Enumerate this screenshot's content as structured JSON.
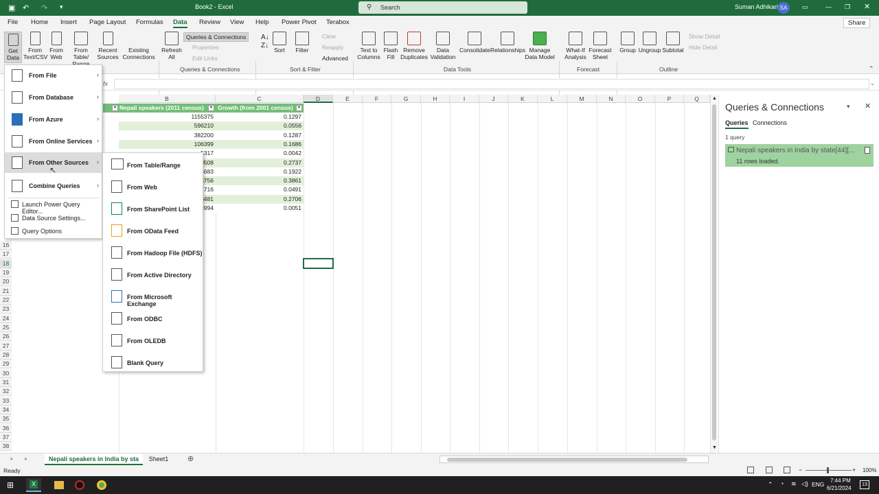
{
  "window": {
    "title": "Book2 - Excel",
    "search_placeholder": "Search",
    "user": "Suman Adhikari",
    "avatar": "SA",
    "share": "Share"
  },
  "menu": [
    "File",
    "Home",
    "Insert",
    "Page Layout",
    "Formulas",
    "Data",
    "Review",
    "View",
    "Help",
    "Power Pivot",
    "Terabox"
  ],
  "ribbon": {
    "get_data": "Get Data",
    "from_text_csv": "From Text/CSV",
    "from_web": "From Web",
    "from_table_range": "From Table/ Range",
    "recent_sources": "Recent Sources",
    "existing_connections": "Existing Connections",
    "refresh_all": "Refresh All",
    "queries_connections": "Queries & Connections",
    "properties": "Properties",
    "edit_links": "Edit Links",
    "group_qc": "Queries & Connections",
    "sort": "Sort",
    "filter": "Filter",
    "clear": "Clear",
    "reapply": "Reapply",
    "advanced": "Advanced",
    "group_sf": "Sort & Filter",
    "text_to_columns": "Text to Columns",
    "flash_fill": "Flash Fill",
    "remove_duplicates": "Remove Duplicates",
    "data_validation": "Data Validation",
    "consolidate": "Consolidate",
    "relationships": "Relationships",
    "manage_data_model": "Manage Data Model",
    "group_dt": "Data Tools",
    "what_if": "What-If Analysis",
    "forecast_sheet": "Forecast Sheet",
    "group_fc": "Forecast",
    "group": "Group",
    "ungroup": "Ungroup",
    "subtotal": "Subtotal",
    "show_detail": "Show Detail",
    "hide_detail": "Hide Detail",
    "group_ol": "Outline"
  },
  "formula_bar": {
    "fx": "fx"
  },
  "columns": [
    "B",
    "C",
    "D",
    "E",
    "F",
    "G",
    "H",
    "I",
    "J",
    "K",
    "L",
    "M",
    "N",
    "O",
    "P",
    "Q"
  ],
  "rows": [
    "16",
    "17",
    "18",
    "19",
    "20",
    "21",
    "22",
    "23",
    "24",
    "25",
    "26",
    "27",
    "28",
    "29",
    "30",
    "31",
    "32",
    "33",
    "34",
    "35",
    "36",
    "37",
    "38"
  ],
  "table": {
    "header_b": "Nepali speakers (2011 census)",
    "header_c": "Growth (from 2001 census)",
    "col_b": [
      "1155375",
      "596210",
      "382200",
      "106399",
      "5317",
      "0508",
      "5683",
      "3756",
      "4716",
      "8481",
      "8994"
    ],
    "col_c": [
      "0.1297",
      "0.0556",
      "0.1287",
      "0.1686",
      "0.0042",
      "0.2737",
      "0.1922",
      "0.3861",
      "0.0491",
      "0.2706",
      "0.0051"
    ]
  },
  "dropdown": {
    "items": [
      "From File",
      "From Database",
      "From Azure",
      "From Online Services",
      "From Other Sources",
      "Combine Queries"
    ],
    "small_items": [
      "Launch Power Query Editor...",
      "Data Source Settings...",
      "Query Options"
    ]
  },
  "submenu": [
    "From Table/Range",
    "From Web",
    "From SharePoint List",
    "From OData Feed",
    "From Hadoop File (HDFS)",
    "From Active Directory",
    "From Microsoft Exchange",
    "From ODBC",
    "From OLEDB",
    "Blank Query"
  ],
  "queries_pane": {
    "title": "Queries & Connections",
    "tab_queries": "Queries",
    "tab_connections": "Connections",
    "count": "1 query",
    "item_name": "Nepali speakers in India by state[44][...",
    "item_status": "11 rows loaded."
  },
  "sheets": {
    "active": "Nepali speakers in India by sta",
    "other": "Sheet1"
  },
  "status": {
    "ready": "Ready",
    "zoom": "100%"
  },
  "taskbar": {
    "lang": "ENG",
    "time": "7:44 PM",
    "date": "6/21/2024",
    "notif": "13"
  }
}
